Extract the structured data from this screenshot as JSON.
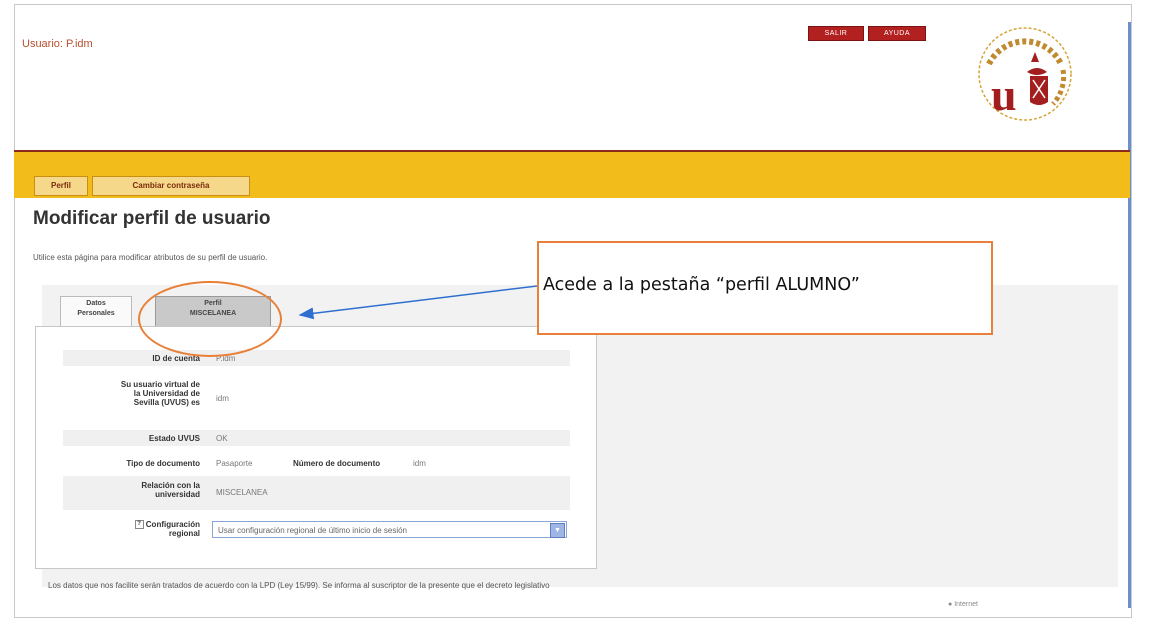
{
  "header": {
    "user_label": "Usuario: P.idm",
    "salir_label": "SALIR",
    "ayuda_label": "AYUDA",
    "logo_icon": "universidad-de-sevilla-seal-icon"
  },
  "menu": {
    "tabs": [
      {
        "label": "Perfil"
      },
      {
        "label": "Cambiar contraseña"
      }
    ]
  },
  "page": {
    "title": "Modificar perfil de usuario",
    "description": "Utilice esta página para modificar atributos de su perfil de usuario."
  },
  "profile_tabs": {
    "datos_line1": "Datos",
    "datos_line2": "Personales",
    "perfil_line1": "Perfil",
    "perfil_line2": "MISCELANEA"
  },
  "form": {
    "id_label": "ID de cuenta",
    "id_value": "P.idm",
    "uvus_label_1": "Su usuario virtual de",
    "uvus_label_2": "la Universidad de",
    "uvus_label_3": "Sevilla (UVUS) es",
    "uvus_value": "idm",
    "estado_label": "Estado UVUS",
    "estado_value": "OK",
    "tipo_label": "Tipo de documento",
    "tipo_value": "Pasaporte",
    "numero_label": "Número de documento",
    "numero_value": "idm",
    "relacion_label_1": "Relación con la",
    "relacion_label_2": "universidad",
    "relacion_value": "MISCELANEA",
    "config_label_1": "Configuración",
    "config_label_2": "regional",
    "config_select_value": "Usar configuración regional de último inicio de sesión"
  },
  "footer": {
    "text": "Los datos que nos facilite serán tratados de acuerdo con la LPD (Ley 15/99). Se informa al suscriptor de la presente que el decreto legislativo",
    "status": "Internet"
  },
  "annotation": {
    "callout_text": "Acede a la pestaña “perfil ALUMNO”"
  },
  "colors": {
    "accent_orange_bar": "#f2bd1a",
    "callout_border": "#e8803a",
    "arrow": "#2e6fd0",
    "header_red": "#b32020"
  }
}
